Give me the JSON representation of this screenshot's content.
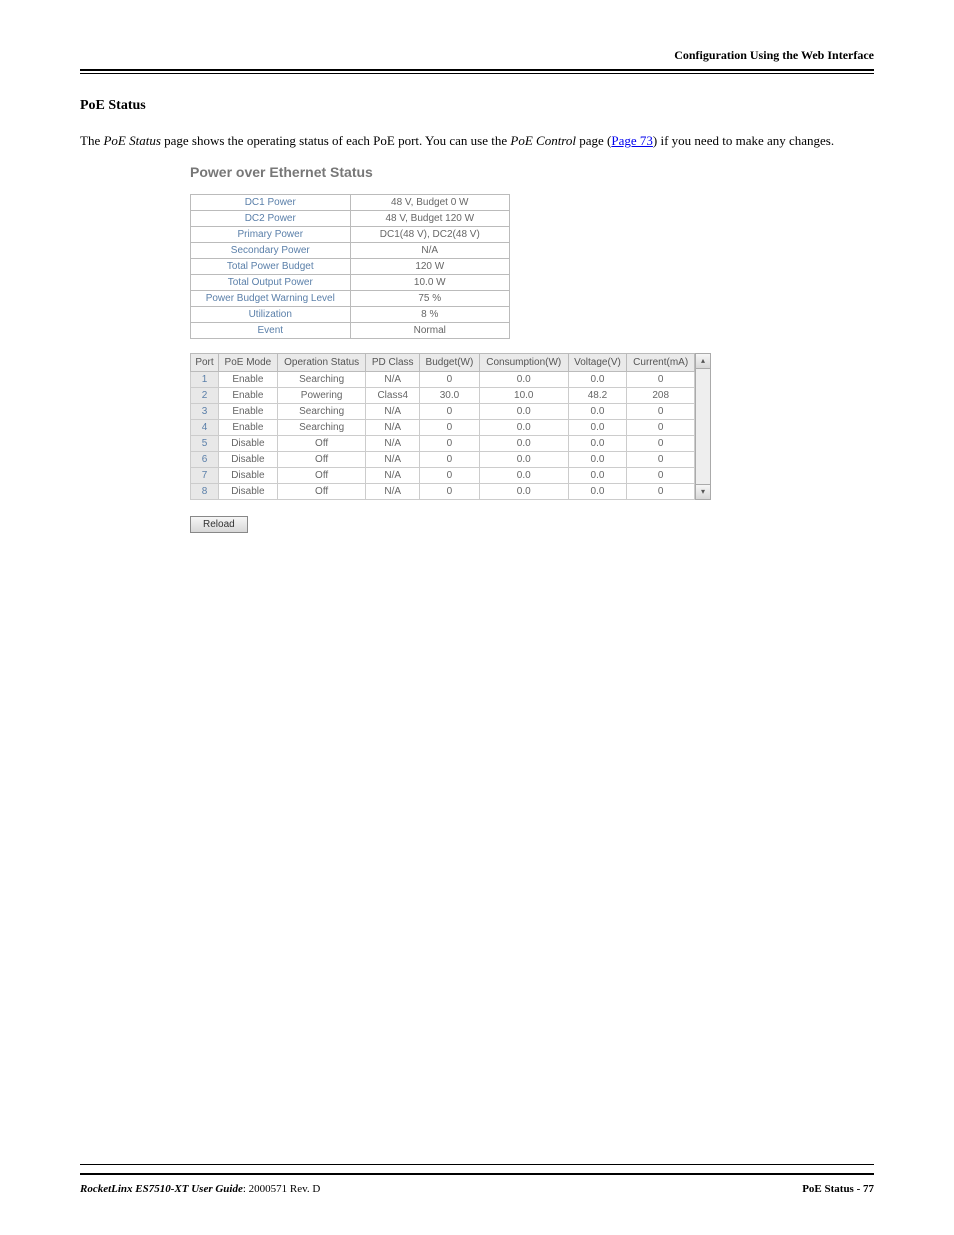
{
  "header": {
    "running_head": "Configuration Using the Web Interface"
  },
  "section": {
    "title": "PoE Status",
    "intro_pre": "The ",
    "intro_em1": "PoE Status",
    "intro_mid": " page shows the operating status of each PoE port. You can use the ",
    "intro_em2": "PoE Control",
    "intro_post1": " page (",
    "intro_link": "Page 73",
    "intro_post2": ") if you need to make any changes."
  },
  "screenshot": {
    "title": "Power over Ethernet Status",
    "summary": [
      {
        "label": "DC1 Power",
        "value": "48 V, Budget 0 W"
      },
      {
        "label": "DC2 Power",
        "value": "48 V, Budget 120 W"
      },
      {
        "label": "Primary Power",
        "value": "DC1(48 V), DC2(48 V)"
      },
      {
        "label": "Secondary Power",
        "value": "N/A"
      },
      {
        "label": "Total Power Budget",
        "value": "120 W"
      },
      {
        "label": "Total Output Power",
        "value": "10.0 W"
      },
      {
        "label": "Power Budget Warning Level",
        "value": "75 %"
      },
      {
        "label": "Utilization",
        "value": "8 %"
      },
      {
        "label": "Event",
        "value": "Normal"
      }
    ],
    "ports_headers": [
      "Port",
      "PoE Mode",
      "Operation Status",
      "PD Class",
      "Budget(W)",
      "Consumption(W)",
      "Voltage(V)",
      "Current(mA)"
    ],
    "ports": [
      {
        "port": "1",
        "mode": "Enable",
        "op": "Searching",
        "class": "N/A",
        "budget": "0",
        "cons": "0.0",
        "volt": "0.0",
        "curr": "0"
      },
      {
        "port": "2",
        "mode": "Enable",
        "op": "Powering",
        "class": "Class4",
        "budget": "30.0",
        "cons": "10.0",
        "volt": "48.2",
        "curr": "208"
      },
      {
        "port": "3",
        "mode": "Enable",
        "op": "Searching",
        "class": "N/A",
        "budget": "0",
        "cons": "0.0",
        "volt": "0.0",
        "curr": "0"
      },
      {
        "port": "4",
        "mode": "Enable",
        "op": "Searching",
        "class": "N/A",
        "budget": "0",
        "cons": "0.0",
        "volt": "0.0",
        "curr": "0"
      },
      {
        "port": "5",
        "mode": "Disable",
        "op": "Off",
        "class": "N/A",
        "budget": "0",
        "cons": "0.0",
        "volt": "0.0",
        "curr": "0"
      },
      {
        "port": "6",
        "mode": "Disable",
        "op": "Off",
        "class": "N/A",
        "budget": "0",
        "cons": "0.0",
        "volt": "0.0",
        "curr": "0"
      },
      {
        "port": "7",
        "mode": "Disable",
        "op": "Off",
        "class": "N/A",
        "budget": "0",
        "cons": "0.0",
        "volt": "0.0",
        "curr": "0"
      },
      {
        "port": "8",
        "mode": "Disable",
        "op": "Off",
        "class": "N/A",
        "budget": "0",
        "cons": "0.0",
        "volt": "0.0",
        "curr": "0"
      }
    ],
    "reload_label": "Reload"
  },
  "footer": {
    "guide_title": "RocketLinx ES7510-XT  User Guide",
    "guide_rev": ": 2000571 Rev. D",
    "page_label": "PoE Status - 77"
  }
}
